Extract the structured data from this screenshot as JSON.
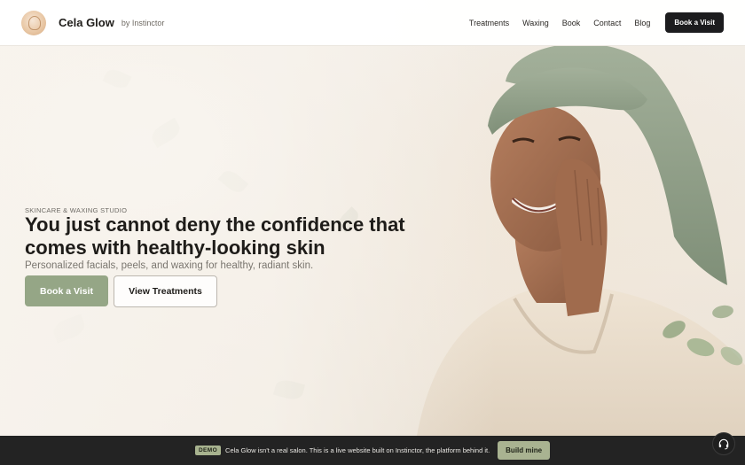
{
  "header": {
    "brand_name": "Cela Glow",
    "brand_by": "by Instinctor",
    "nav": [
      "Treatments",
      "Waxing",
      "Book",
      "Contact",
      "Blog"
    ],
    "cta": "Book a Visit"
  },
  "hero": {
    "eyebrow": "SKINCARE & WAXING STUDIO",
    "headline": "You just cannot deny the confidence that comes with healthy-looking skin",
    "subhead": "Personalized facials, peels, and waxing for healthy, radiant skin.",
    "primary_button": "Book a Visit",
    "secondary_button": "View Treatments"
  },
  "demo_bar": {
    "badge": "DEMO",
    "text": "Cela Glow isn't a real salon. This is a live website built on Instinctor, the platform behind it.",
    "cta": "Build mine"
  },
  "icons": {
    "logo": "floral-portrait-logo",
    "support": "headset-icon"
  },
  "colors": {
    "accent": "#95a686",
    "dark": "#1c1c1e",
    "demo_bar": "#232323"
  }
}
